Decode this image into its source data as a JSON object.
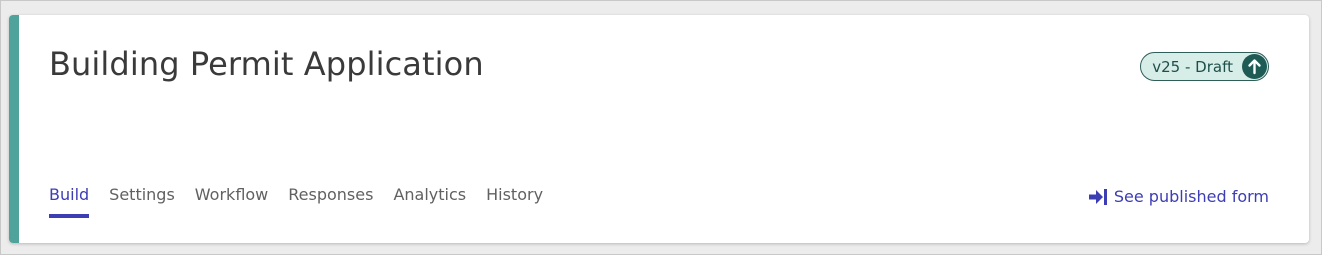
{
  "header": {
    "title": "Building Permit Application",
    "version_badge": {
      "label": "v25 - Draft",
      "icon": "publish-up-arrow-icon",
      "background_color": "#d6ede8",
      "border_color": "#2f5d58",
      "icon_color": "#1e5b55"
    }
  },
  "accent_color": "#4fa39b",
  "tabs": [
    {
      "label": "Build",
      "active": true
    },
    {
      "label": "Settings",
      "active": false
    },
    {
      "label": "Workflow",
      "active": false
    },
    {
      "label": "Responses",
      "active": false
    },
    {
      "label": "Analytics",
      "active": false
    },
    {
      "label": "History",
      "active": false
    }
  ],
  "published_link": {
    "label": "See published form",
    "icon": "arrow-right-to-bar-icon",
    "color": "#3d3db4"
  }
}
